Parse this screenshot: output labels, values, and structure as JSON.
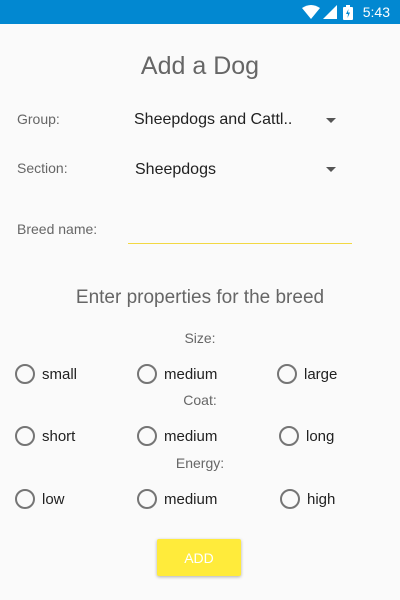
{
  "status_bar": {
    "time": "5:43"
  },
  "page": {
    "title": "Add a Dog"
  },
  "form": {
    "group_label": "Group:",
    "group_value": "Sheepdogs and Cattl..",
    "section_label": "Section:",
    "section_value": "Sheepdogs",
    "breed_label": "Breed name:",
    "breed_value": ""
  },
  "properties": {
    "heading": "Enter properties for the breed",
    "size": {
      "label": "Size:",
      "options": [
        "small",
        "medium",
        "large"
      ]
    },
    "coat": {
      "label": "Coat:",
      "options": [
        "short",
        "medium",
        "long"
      ]
    },
    "energy": {
      "label": "Energy:",
      "options": [
        "low",
        "medium",
        "high"
      ]
    }
  },
  "actions": {
    "add_label": "ADD"
  },
  "colors": {
    "status_bar": "#0288d1",
    "accent": "#ffeb3b",
    "underline": "#f2d843"
  }
}
